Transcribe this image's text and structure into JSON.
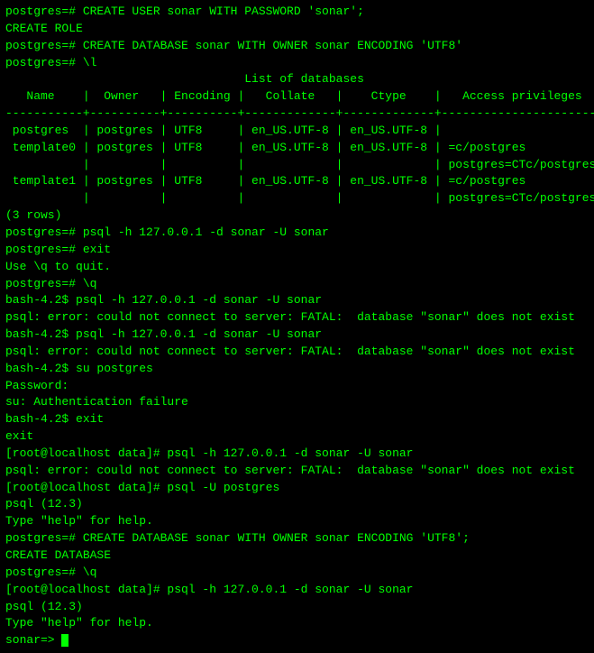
{
  "terminal": {
    "lines": [
      "postgres=# CREATE USER sonar WITH PASSWORD 'sonar';",
      "CREATE ROLE",
      "postgres=# CREATE DATABASE sonar WITH OWNER sonar ENCODING 'UTF8'",
      "postgres=# \\l",
      "                                  List of databases",
      "   Name    |  Owner   | Encoding |   Collate   |    Ctype    |   Access privileges   ",
      "-----------+----------+----------+-------------+-------------+-----------------------",
      " postgres  | postgres | UTF8     | en_US.UTF-8 | en_US.UTF-8 |                       ",
      " template0 | postgres | UTF8     | en_US.UTF-8 | en_US.UTF-8 | =c/postgres          +",
      "           |          |          |             |             | postgres=CTc/postgres",
      " template1 | postgres | UTF8     | en_US.UTF-8 | en_US.UTF-8 | =c/postgres          +",
      "           |          |          |             |             | postgres=CTc/postgres",
      "(3 rows)",
      "",
      "postgres=# psql -h 127.0.0.1 -d sonar -U sonar",
      "postgres=# exit",
      "Use \\q to quit.",
      "postgres=# \\q",
      "bash-4.2$ psql -h 127.0.0.1 -d sonar -U sonar",
      "psql: error: could not connect to server: FATAL:  database \"sonar\" does not exist",
      "bash-4.2$ psql -h 127.0.0.1 -d sonar -U sonar",
      "psql: error: could not connect to server: FATAL:  database \"sonar\" does not exist",
      "bash-4.2$ su postgres",
      "Password:",
      "su: Authentication failure",
      "bash-4.2$ exit",
      "exit",
      "[root@localhost data]# psql -h 127.0.0.1 -d sonar -U sonar",
      "psql: error: could not connect to server: FATAL:  database \"sonar\" does not exist",
      "[root@localhost data]# psql -U postgres",
      "psql (12.3)",
      "Type \"help\" for help.",
      "",
      "postgres=# CREATE DATABASE sonar WITH OWNER sonar ENCODING 'UTF8';",
      "CREATE DATABASE",
      "postgres=# \\q",
      "[root@localhost data]# psql -h 127.0.0.1 -d sonar -U sonar",
      "psql (12.3)",
      "Type \"help\" for help.",
      "",
      "sonar=> "
    ],
    "cursor_visible": true
  }
}
